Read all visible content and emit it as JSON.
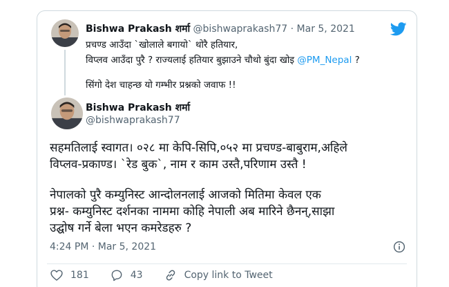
{
  "parent": {
    "name": "Bishwa Prakash शर्मा",
    "handle": "@bishwaprakash77",
    "sep": "·",
    "date": "Mar 5, 2021",
    "lines": [
      "प्रचण्ड आउँदा `खोलाले बगायो` थोरै हतियार,",
      "विप्लव आउँदा पुरै ? राज्यलाई हतियार बुझाउने चौथो बुंदा खोइ ",
      "सिंगो देश चाहन्छ यो गम्भीर प्रश्नको जवाफ !!"
    ],
    "mention": "@PM_Nepal",
    "line2_end": " ?"
  },
  "main": {
    "name": "Bishwa Prakash शर्मा",
    "handle": "@bishwaprakash77",
    "lines": [
      "सहमतिलाई स्वागत। ०२८ मा केपि-सिपि,०५२ मा प्रचण्ड-बाबुराम,अहिले",
      "विप्लव-प्रकाण्ड। `रेड बुक`, नाम र काम उस्तै,परिणाम उस्तै !",
      "नेपालको पुरै कम्युनिस्ट आन्दोलनलाई आजको मितिमा केवल एक",
      "प्रश्न- कम्युनिस्ट दर्शनका नाममा कोहि नेपाली अब मारिने छैनन्,साझा",
      "उद्घोष गर्ने बेला भएन कमरेडहरु ?"
    ],
    "time": "4:24 PM · Mar 5, 2021"
  },
  "actions": {
    "likes": "181",
    "replies": "43",
    "copy_link": "Copy link to Tweet"
  },
  "icons": {
    "bird": "twitter-bird-icon",
    "info": "info-icon",
    "heart": "heart-icon",
    "reply": "reply-icon",
    "link": "link-icon"
  },
  "colors": {
    "brand": "#1d9bf0",
    "text": "#0f1419",
    "muted": "#536471",
    "border": "#cfd9de"
  }
}
